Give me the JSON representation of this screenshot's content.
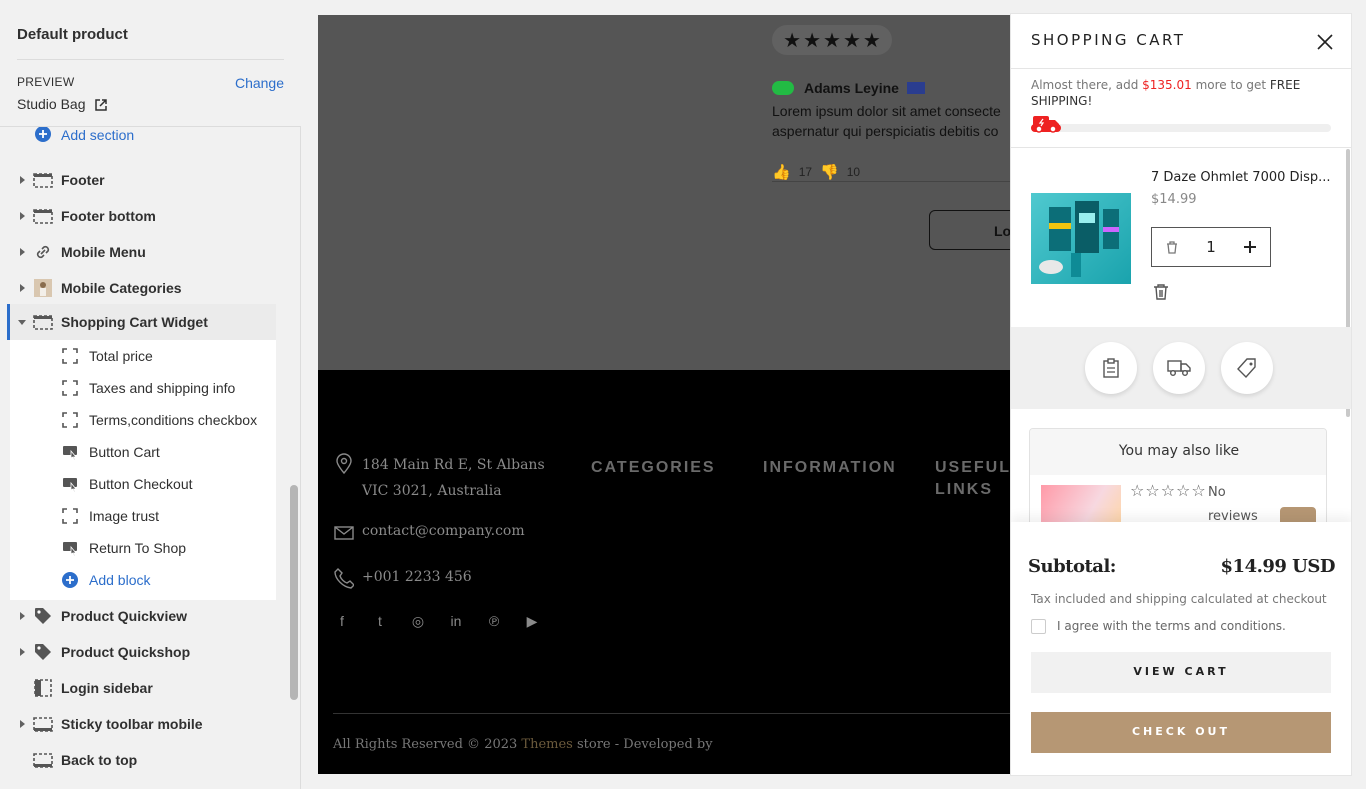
{
  "sidebar": {
    "title": "Default product",
    "preview_label": "PREVIEW",
    "change_label": "Change",
    "preview_value": "Studio Bag",
    "add_section": "Add section",
    "items_top": [
      {
        "label": "Footer",
        "icon": "section-icon"
      },
      {
        "label": "Footer bottom",
        "icon": "section-icon"
      },
      {
        "label": "Mobile Menu",
        "icon": "link-icon"
      },
      {
        "label": "Mobile Categories",
        "icon": "image-thumb-icon"
      }
    ],
    "expanded": {
      "label": "Shopping Cart Widget",
      "blocks": [
        {
          "label": "Total price",
          "icon": "block-icon"
        },
        {
          "label": "Taxes and shipping info",
          "icon": "block-icon"
        },
        {
          "label": "Terms,conditions checkbox",
          "icon": "block-icon"
        },
        {
          "label": "Button Cart",
          "icon": "button-block-icon"
        },
        {
          "label": "Button Checkout",
          "icon": "button-block-icon"
        },
        {
          "label": "Image trust",
          "icon": "block-icon"
        },
        {
          "label": "Return To Shop",
          "icon": "button-block-icon"
        }
      ],
      "add_block": "Add block"
    },
    "items_bottom": [
      {
        "label": "Product Quickview",
        "icon": "tag-icon"
      },
      {
        "label": "Product Quickshop",
        "icon": "tag-icon"
      },
      {
        "label": "Login sidebar",
        "icon": "sidebar-layout-icon"
      },
      {
        "label": "Sticky toolbar mobile",
        "icon": "section-icon"
      },
      {
        "label": "Back to top",
        "icon": "section-icon"
      }
    ]
  },
  "preview": {
    "reviewer": "Adams Leyine",
    "review_text_1": "Lorem ipsum dolor sit amet consecte",
    "review_text_2": "aspernatur qui perspiciatis debitis co",
    "likes": "17",
    "dislikes": "10",
    "load_more": "Lo",
    "address_1": "184 Main Rd E, St Albans",
    "address_2": "VIC 3021, Australia",
    "email": "contact@company.com",
    "phone": "+001 2233 456",
    "col_categories": "CATEGORIES",
    "col_information": "INFORMATION",
    "col_useful_1": "USEFUL",
    "col_useful_2": "LINKS",
    "copyright_prefix": "All Rights Reserved © 2023",
    "copyright_brand": "Themes",
    "copyright_suffix": "store - Developed by"
  },
  "cart": {
    "title": "SHOPPING CART",
    "ship_prefix": "Almost there, add",
    "ship_amount": "$135.01",
    "ship_middle": "more to get",
    "ship_free": "FREE SHIPPING!",
    "ship_progress": 0.1,
    "item_name": "7 Daze Ohmlet 7000 Disp...",
    "item_price": "$14.99",
    "item_qty": "1",
    "also_title": "You may also like",
    "also_stars": "☆☆☆☆☆",
    "also_reviews": "No reviews",
    "subtotal_label": "Subtotal:",
    "subtotal_value": "$14.99 USD",
    "tax_text": "Tax included and shipping calculated at checkout",
    "terms_text": "I agree with the terms and conditions.",
    "view_cart": "VIEW CART",
    "checkout": "CHECK OUT",
    "accent": "#b69774",
    "alert": "#e22222"
  }
}
